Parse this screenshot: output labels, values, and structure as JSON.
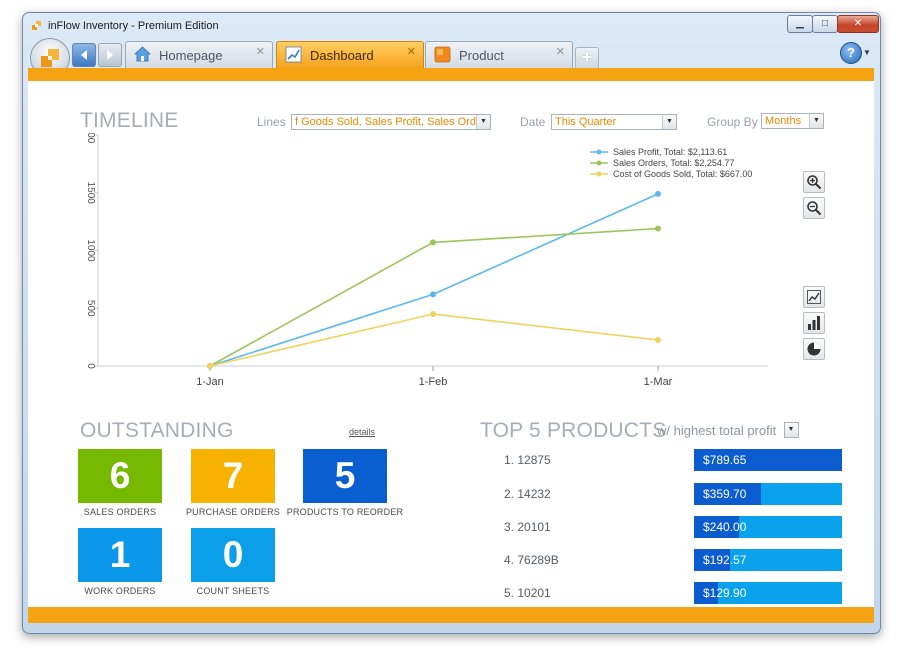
{
  "window": {
    "title": "inFlow Inventory - Premium Edition"
  },
  "tabs": [
    {
      "label": "Homepage",
      "icon": "house-icon",
      "close": "✕"
    },
    {
      "label": "Dashboard",
      "icon": "chart-pencil-icon",
      "close": "✕",
      "active": true
    },
    {
      "label": "Product",
      "icon": "product-box-icon",
      "close": "✕"
    }
  ],
  "help_label": "?",
  "timeline": {
    "title": "TIMELINE",
    "lines_label": "Lines",
    "lines_value": "f Goods Sold, Sales Profit, Sales Orders",
    "date_label": "Date",
    "date_value": "This Quarter",
    "group_label": "Group By",
    "group_value": "Months"
  },
  "chart_data": {
    "type": "line",
    "x": [
      "1-Jan",
      "1-Feb",
      "1-Mar"
    ],
    "ylim": [
      0,
      2000
    ],
    "yticks": [
      "0",
      "500",
      "1000",
      "1500",
      "000"
    ],
    "grid": false,
    "legend_position": "top-right",
    "series": [
      {
        "name": "Sales Profit, Total: $2,113.61",
        "color": "#5bb8ef",
        "values": [
          0,
          620,
          1490
        ]
      },
      {
        "name": "Sales Orders, Total: $2,254.77",
        "color": "#9cc65a",
        "values": [
          0,
          1070,
          1190
        ]
      },
      {
        "name": "Cost of Goods Sold, Total: $667.00",
        "color": "#f2d25f",
        "values": [
          0,
          450,
          225
        ]
      }
    ]
  },
  "outstanding": {
    "title": "OUTSTANDING",
    "details": "details",
    "tiles": [
      {
        "count": "6",
        "label": "SALES ORDERS",
        "color": "#77b800"
      },
      {
        "count": "7",
        "label": "PURCHASE ORDERS",
        "color": "#f7b200"
      },
      {
        "count": "5",
        "label": "PRODUCTS TO REORDER",
        "color": "#0a5fd0"
      },
      {
        "count": "1",
        "label": "WORK ORDERS",
        "color": "#0b97ea"
      },
      {
        "count": "0",
        "label": "COUNT SHEETS",
        "color": "#0a9fe8"
      }
    ]
  },
  "top_products": {
    "title": "TOP 5 PRODUCTS",
    "criteria": "w/ highest total profit",
    "items": [
      {
        "name": "1. 12875",
        "value": "$789.65",
        "share": 1.0
      },
      {
        "name": "2. 14232",
        "value": "$359.70",
        "share": 0.455
      },
      {
        "name": "3. 20101",
        "value": "$240.00",
        "share": 0.304
      },
      {
        "name": "4. 76289B",
        "value": "$192.57",
        "share": 0.244
      },
      {
        "name": "5. 10201",
        "value": "$129.90",
        "share": 0.165
      }
    ]
  }
}
